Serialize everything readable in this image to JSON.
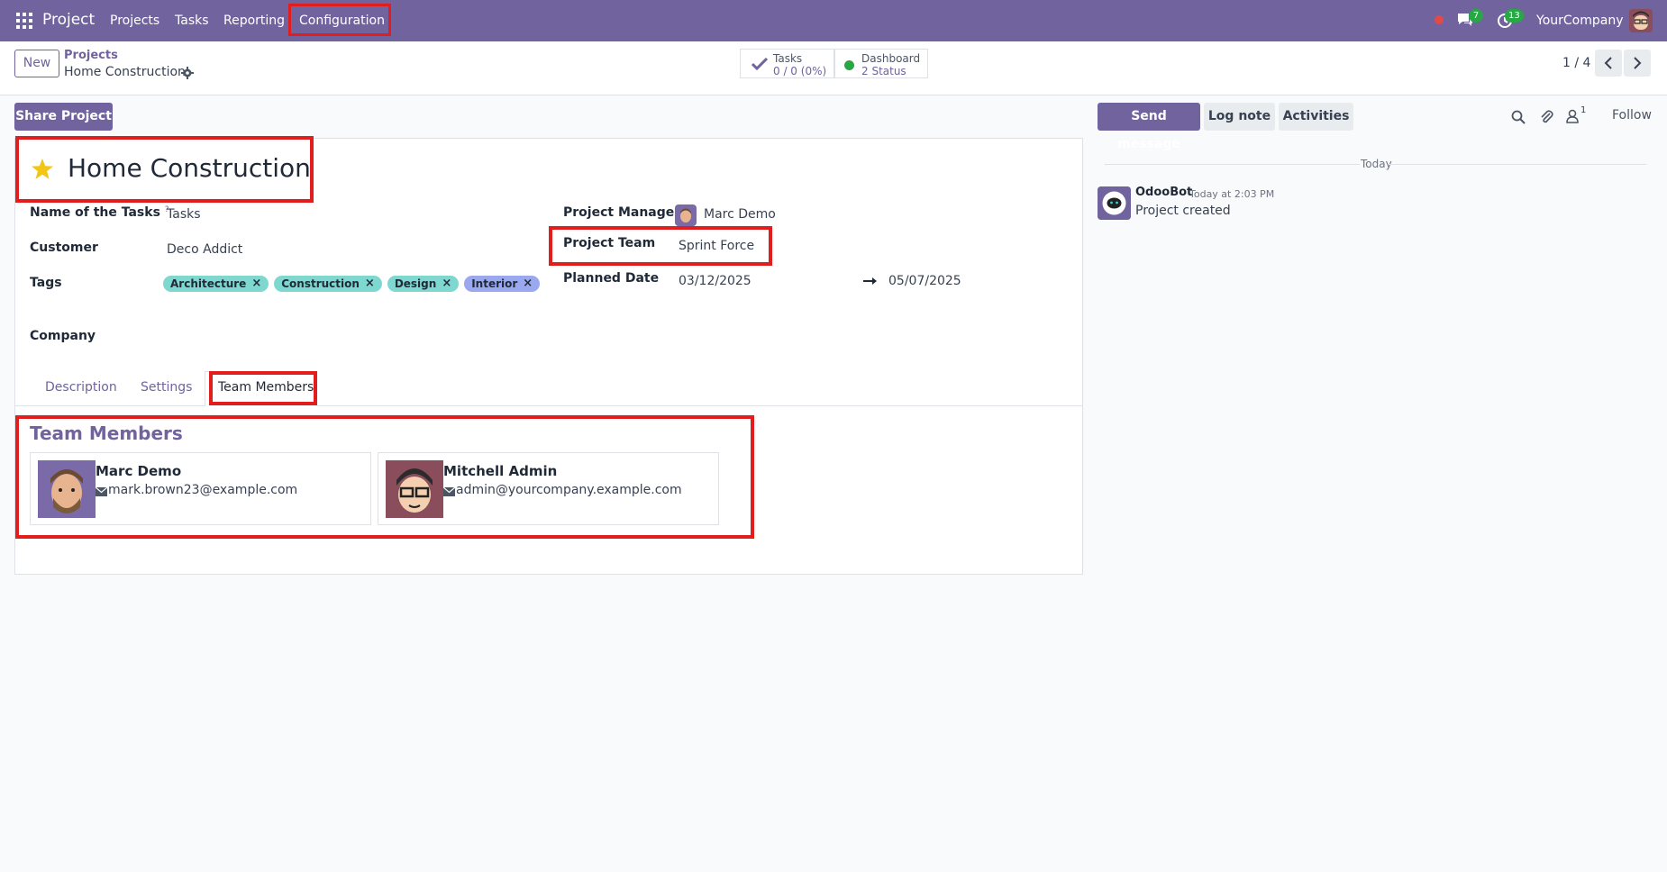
{
  "navbar": {
    "brand": "Project",
    "menu": [
      "Projects",
      "Tasks",
      "Reporting",
      "Configuration"
    ],
    "chat_count": "7",
    "activity_count": "13",
    "company": "YourCompany"
  },
  "control": {
    "new_label": "New",
    "breadcrumb_parent": "Projects",
    "breadcrumb_current": "Home Construction",
    "smart_buttons": [
      {
        "title": "Tasks",
        "value": "0 / 0 (0%)"
      },
      {
        "title": "Dashboard",
        "value": "2 Status"
      }
    ],
    "pager": "1 / 4"
  },
  "form": {
    "share_label": "Share Project",
    "title": "Home Construction",
    "fields": {
      "tasks_label": "Name of the Tasks",
      "tasks_help": "?",
      "tasks_value": "Tasks",
      "customer_label": "Customer",
      "customer_value": "Deco Addict",
      "tags_label": "Tags",
      "tags": [
        {
          "name": "Architecture",
          "color": "#7fd8cf"
        },
        {
          "name": "Construction",
          "color": "#7fd8cf"
        },
        {
          "name": "Design",
          "color": "#7fd8cf"
        },
        {
          "name": "Interior",
          "color": "#9aa8ef"
        }
      ],
      "company_label": "Company",
      "pm_label": "Project Manager",
      "pm_value": "Marc Demo",
      "team_label": "Project Team",
      "team_value": "Sprint Force",
      "planned_label": "Planned Date",
      "planned_start": "03/12/2025",
      "planned_end": "05/07/2025"
    },
    "tabs": [
      "Description",
      "Settings",
      "Team Members"
    ],
    "section_title": "Team Members",
    "members": [
      {
        "name": "Marc Demo",
        "email": "mark.brown23@example.com"
      },
      {
        "name": "Mitchell Admin",
        "email": "admin@yourcompany.example.com"
      }
    ]
  },
  "chatter": {
    "send_label": "Send message",
    "log_label": "Log note",
    "activities_label": "Activities",
    "follower_count": "1",
    "follow_label": "Follow",
    "day_label": "Today",
    "message": {
      "author": "OdooBot",
      "date": "Today at 2:03 PM",
      "body": "Project created"
    }
  },
  "colors": {
    "brand": "#71639e",
    "highlight": "#e11d1d",
    "success": "#28a745"
  }
}
